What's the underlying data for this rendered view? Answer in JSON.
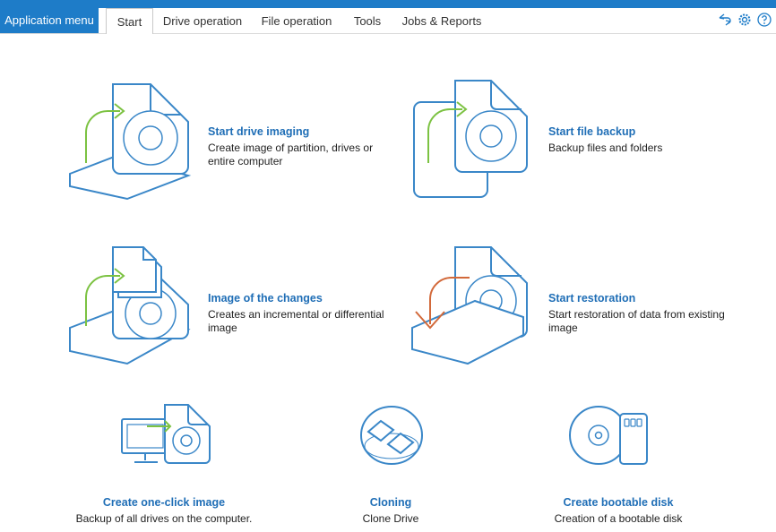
{
  "ribbon": {
    "app_menu": "Application menu",
    "tabs": [
      {
        "label": "Start",
        "active": true
      },
      {
        "label": "Drive operation"
      },
      {
        "label": "File operation"
      },
      {
        "label": "Tools"
      },
      {
        "label": "Jobs & Reports"
      }
    ],
    "icons": [
      "sync-icon",
      "gear-icon",
      "help-icon"
    ]
  },
  "colors": {
    "accent": "#1e7cc8",
    "icon_blue": "#3a87c8",
    "green": "#7cc242",
    "orange": "#d2693a",
    "title": "#1f6eb6"
  },
  "actions": {
    "drive_imaging": {
      "title": "Start drive imaging",
      "desc": "Create image of partition, drives or entire computer"
    },
    "file_backup": {
      "title": "Start file backup",
      "desc": "Backup files and folders"
    },
    "image_changes": {
      "title": "Image of the changes",
      "desc": "Creates an incremental or differential image"
    },
    "restoration": {
      "title": "Start restoration",
      "desc": "Start restoration of data from existing image"
    },
    "one_click": {
      "title": "Create one-click image",
      "desc": "Backup of all drives on the computer."
    },
    "cloning": {
      "title": "Cloning",
      "desc": "Clone Drive"
    },
    "bootable": {
      "title": "Create bootable disk",
      "desc": "Creation of a bootable disk"
    }
  }
}
